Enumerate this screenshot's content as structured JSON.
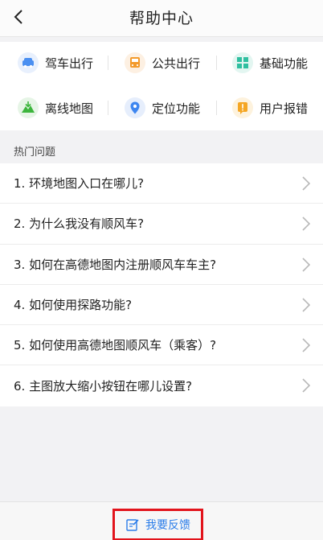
{
  "header": {
    "title": "帮助中心"
  },
  "categories": [
    {
      "label": "驾车出行",
      "icon": "car-icon",
      "color": "#4a8ff1"
    },
    {
      "label": "公共出行",
      "icon": "bus-icon",
      "color": "#f39a2b"
    },
    {
      "label": "基础功能",
      "icon": "grid-icon",
      "color": "#2fbfa0"
    },
    {
      "label": "离线地图",
      "icon": "offline-map-icon",
      "color": "#3cb53c"
    },
    {
      "label": "定位功能",
      "icon": "location-pin-icon",
      "color": "#3e86f0"
    },
    {
      "label": "用户报错",
      "icon": "report-icon",
      "color": "#f5a623"
    }
  ],
  "hot": {
    "label": "热门问题",
    "items": [
      "1. 环境地图入口在哪儿?",
      "2. 为什么我没有顺风车?",
      "3. 如何在高德地图内注册顺风车车主?",
      "4. 如何使用探路功能?",
      "5. 如何使用高德地图顺风车（乘客）?",
      "6. 主图放大缩小按钮在哪儿设置?"
    ]
  },
  "bottom": {
    "feedback_label": "我要反馈"
  }
}
